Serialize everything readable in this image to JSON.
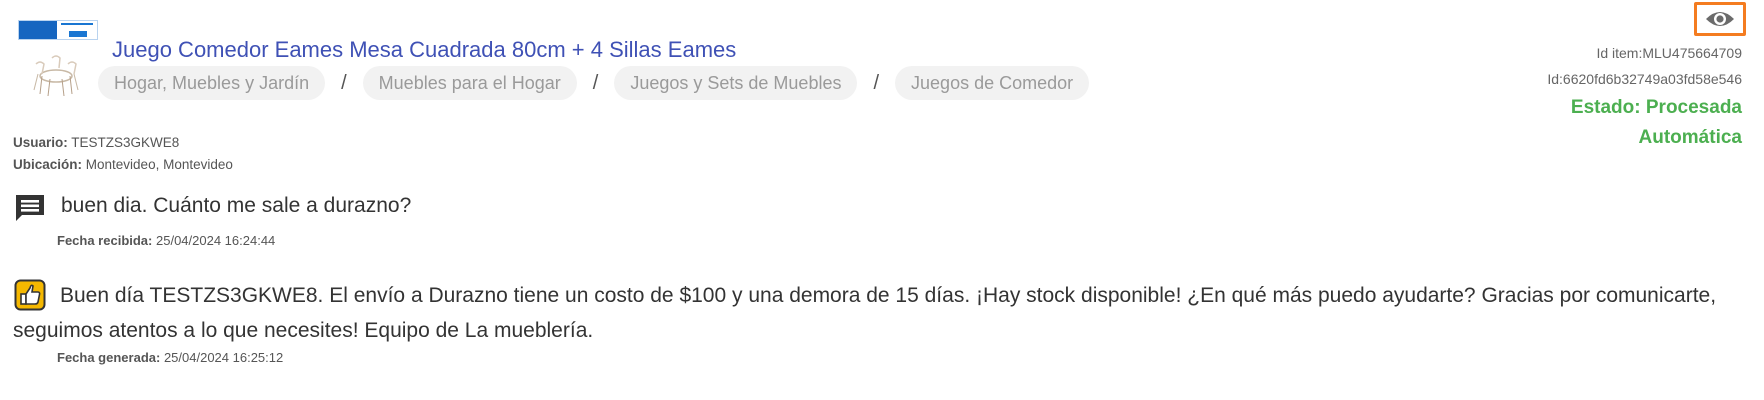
{
  "product": {
    "title": "Juego Comedor Eames Mesa Cuadrada 80cm + 4 Sillas Eames",
    "breadcrumb": [
      "Hogar, Muebles y Jardín",
      "Muebles para el Hogar",
      "Juegos y Sets de Muebles",
      "Juegos de Comedor"
    ],
    "breadcrumb_separator": "/"
  },
  "meta": {
    "id_item": "Id item:MLU475664709",
    "id": "Id:6620fd6b32749a03fd58e546",
    "estado_line1": "Estado: Procesada",
    "estado_line2": "Automática"
  },
  "user": {
    "usuario_label": "Usuario:",
    "usuario_value": "TESTZS3GKWE8",
    "ubicacion_label": "Ubicación:",
    "ubicacion_value": "Montevideo, Montevideo"
  },
  "question": {
    "text": "buen dia. Cuánto me sale a durazno?",
    "fecha_label": "Fecha recibida:",
    "fecha_value": "25/04/2024 16:24:44"
  },
  "answer": {
    "text": "Buen día TESTZS3GKWE8. El envío a Durazno tiene un costo de $100 y una demora de 15 días. ¡Hay stock disponible! ¿En qué más puedo ayudarte? Gracias por comunicarte, seguimos atentos a lo que necesites! Equipo de La mueblería.",
    "fecha_label": "Fecha generada:",
    "fecha_value": "25/04/2024 16:25:12"
  },
  "icons": {
    "view": "eye-icon",
    "question": "message-icon",
    "answer": "thumbs-up-icon",
    "thumbnail": "product-thumbnail",
    "banner": "brand-banner"
  },
  "colors": {
    "title": "#3f51b5",
    "status": "#4caf50",
    "highlight": "#f47c20",
    "chip_bg": "#f2f2f2",
    "chip_text": "#9a9a9a",
    "answer_icon": "#f5b800"
  }
}
